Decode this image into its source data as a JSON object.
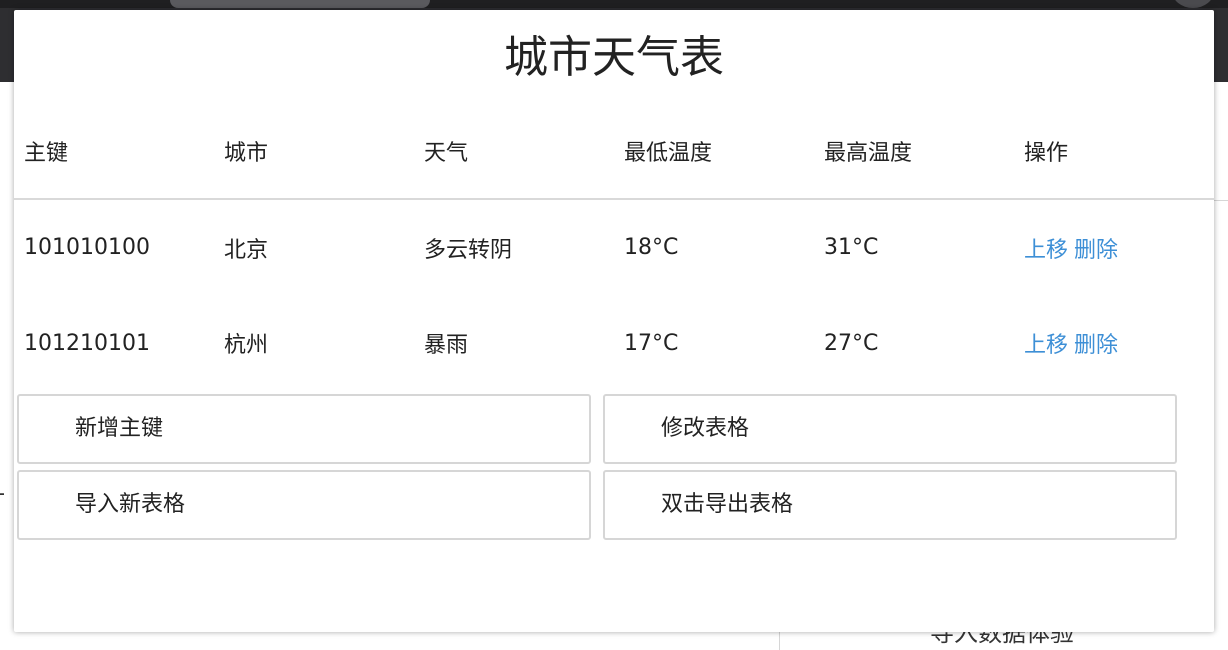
{
  "background": {
    "bottom_text": "导入数据体验"
  },
  "modal": {
    "title": "城市天气表"
  },
  "table": {
    "headers": [
      "主键",
      "城市",
      "天气",
      "最低温度",
      "最高温度",
      "操作"
    ],
    "rows": [
      {
        "id": "101010100",
        "city": "北京",
        "weather": "多云转阴",
        "low": "18°C",
        "high": "31°C",
        "op_up": "上移",
        "op_delete": "删除"
      },
      {
        "id": "101210101",
        "city": "杭州",
        "weather": "暴雨",
        "low": "17°C",
        "high": "27°C",
        "op_up": "上移",
        "op_delete": "删除"
      }
    ]
  },
  "actions": {
    "add_key": "新增主键",
    "edit_table": "修改表格",
    "import_table": "导入新表格",
    "export_table": "双击导出表格"
  },
  "colors": {
    "link": "#3d8fd6",
    "topbar": "#2e2e31"
  }
}
